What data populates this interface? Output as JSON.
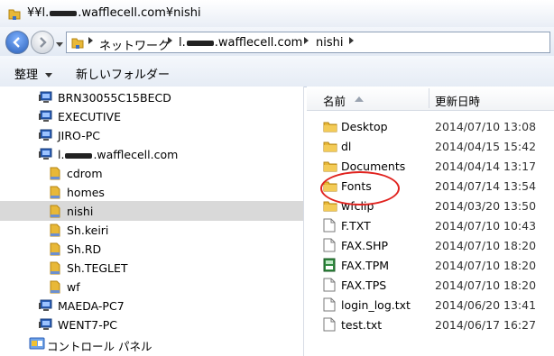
{
  "title": {
    "prefix": "¥¥l.",
    "suffix": ".wafflecell.com¥nishi"
  },
  "address": {
    "crumbs": [
      {
        "label": "ネットワーク"
      },
      {
        "label_prefix": "l.",
        "label_suffix": ".wafflecell.com"
      },
      {
        "label": "nishi"
      }
    ]
  },
  "toolbar": {
    "organize": "整理",
    "new_folder": "新しいフォルダー"
  },
  "tree": [
    {
      "label": "BRN30055C15BECD",
      "type": "computer",
      "indent": 0
    },
    {
      "label": "EXECUTIVE",
      "type": "computer",
      "indent": 0
    },
    {
      "label": "JIRO-PC",
      "type": "computer",
      "indent": 0
    },
    {
      "label_prefix": "l.",
      "label_suffix": ".wafflecell.com",
      "type": "computer",
      "indent": 0
    },
    {
      "label": "cdrom",
      "type": "share",
      "indent": 1
    },
    {
      "label": "homes",
      "type": "share",
      "indent": 1
    },
    {
      "label": "nishi",
      "type": "share",
      "indent": 1,
      "selected": true
    },
    {
      "label": "Sh.keiri",
      "type": "share",
      "indent": 1
    },
    {
      "label": "Sh.RD",
      "type": "share",
      "indent": 1
    },
    {
      "label": "Sh.TEGLET",
      "type": "share",
      "indent": 1
    },
    {
      "label": "wf",
      "type": "share",
      "indent": 1
    },
    {
      "label": "MAEDA-PC7",
      "type": "computer",
      "indent": 0
    },
    {
      "label": "WENT7-PC",
      "type": "computer",
      "indent": 0
    },
    {
      "label": "コントロール パネル",
      "type": "control",
      "indent": -1
    }
  ],
  "columns": {
    "name": "名前",
    "date": "更新日時"
  },
  "files": [
    {
      "name": "Desktop",
      "date": "2014/07/10 13:08",
      "icon": "folder-icon"
    },
    {
      "name": "dl",
      "date": "2014/04/15 15:42",
      "icon": "folder-icon"
    },
    {
      "name": "Documents",
      "date": "2014/04/14 13:17",
      "icon": "folder-icon"
    },
    {
      "name": "Fonts",
      "date": "2014/07/14 13:54",
      "icon": "folder-icon",
      "highlighted": true
    },
    {
      "name": "wfclip",
      "date": "2014/03/20 13:50",
      "icon": "folder-icon"
    },
    {
      "name": "F.TXT",
      "date": "2014/07/10 10:43",
      "icon": "text-file-icon"
    },
    {
      "name": "FAX.SHP",
      "date": "2014/07/10 18:20",
      "icon": "text-file-icon"
    },
    {
      "name": "FAX.TPM",
      "date": "2014/07/10 18:20",
      "icon": "green-file-icon"
    },
    {
      "name": "FAX.TPS",
      "date": "2014/07/10 18:20",
      "icon": "text-file-icon"
    },
    {
      "name": "login_log.txt",
      "date": "2014/06/20 13:41",
      "icon": "text-file-icon"
    },
    {
      "name": "test.txt",
      "date": "2014/06/17 16:27",
      "icon": "text-file-icon"
    }
  ],
  "colors": {
    "selection": "#d9d9d9",
    "highlight_circle": "#e0231f",
    "folder": "#e8b838"
  }
}
